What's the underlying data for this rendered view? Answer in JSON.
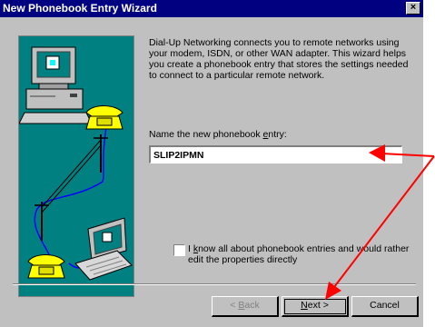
{
  "window": {
    "title": "New Phonebook Entry Wizard",
    "close_glyph": "×"
  },
  "intro_text": "Dial-Up Networking connects you to remote networks using your modem, ISDN, or other WAN adapter.  This wizard helps you create a phonebook entry that stores the settings needed to connect to a particular remote network.",
  "name_field": {
    "label_pre": "Name the new phonebook ",
    "label_ul": "e",
    "label_post": "ntry:",
    "value": "SLIP2IPMN"
  },
  "advanced_checkbox": {
    "checked": false,
    "label_pre": "I ",
    "label_ul": "k",
    "label_post": "now all about phonebook entries and would rather edit the properties directly"
  },
  "buttons": {
    "back": {
      "pre": "< ",
      "ul": "B",
      "post": "ack",
      "enabled": false
    },
    "next": {
      "ul": "N",
      "post": "ext >"
    },
    "cancel": "Cancel"
  },
  "illustration": {
    "icons": [
      "computer-icon",
      "telephone-icon",
      "telephone-pole-icon",
      "laptop-icon",
      "telephone-icon"
    ]
  },
  "annotation_color": "#ff0000",
  "colors": {
    "title_bar": "#000080",
    "dialog_face": "#c0c0c0",
    "illustration_bg": "#008080"
  }
}
